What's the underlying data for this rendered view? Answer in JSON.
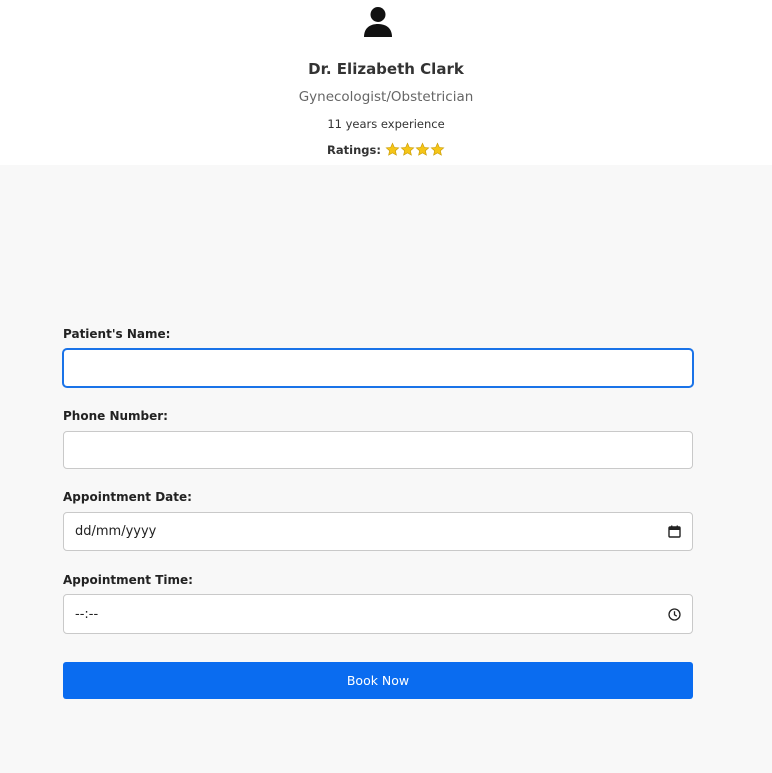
{
  "doctor": {
    "avatar_icon": "user-icon",
    "name": "Dr. Elizabeth Clark",
    "specialty": "Gynecologist/Obstetrician",
    "experience": "11 years experience",
    "ratings_label": "Ratings:",
    "rating_stars": 4
  },
  "form": {
    "patient_name_label": "Patient's Name:",
    "patient_name_value": "",
    "phone_label": "Phone Number:",
    "phone_value": "",
    "date_label": "Appointment Date:",
    "date_placeholder": "dd/mm/yyyy",
    "date_icon": "calendar-icon",
    "time_label": "Appointment Time:",
    "time_placeholder": "--:--",
    "time_icon": "clock-icon",
    "submit_label": "Book Now"
  },
  "colors": {
    "accent": "#0a6cf0",
    "focus": "#1a73e8",
    "star": "#f5c518"
  }
}
